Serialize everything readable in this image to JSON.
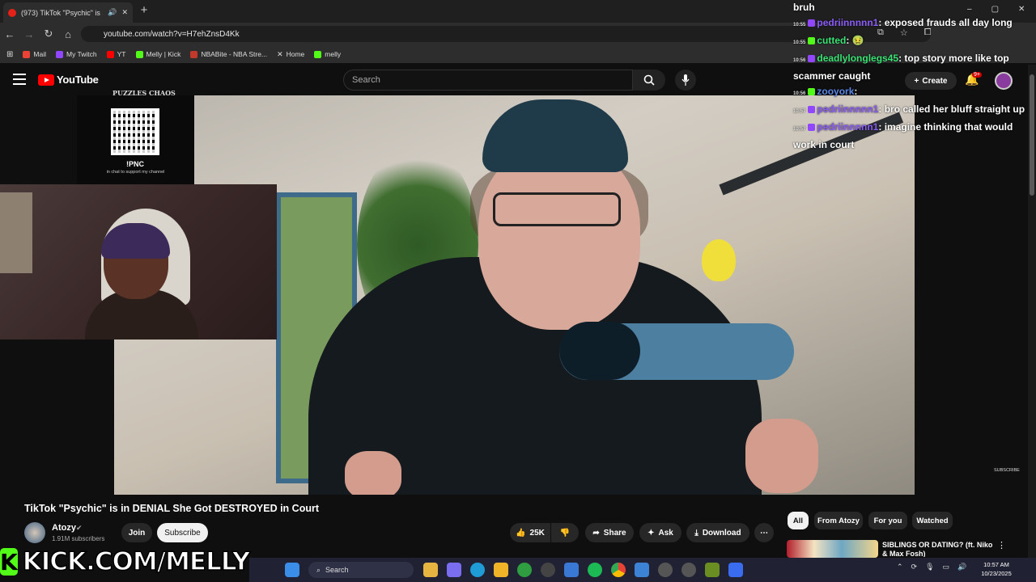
{
  "browser": {
    "tab_title": "(973) TikTok \"Psychic\" is in",
    "url": "youtube.com/watch?v=H7ehZnsD4Kk",
    "new_tab": "+",
    "bookmarks": [
      {
        "label": "Mail",
        "color": "#ea4335"
      },
      {
        "label": "My Twitch",
        "color": "#9146ff"
      },
      {
        "label": "YT",
        "color": "#ff0000"
      },
      {
        "label": "Melly | Kick",
        "color": "#53fc18"
      },
      {
        "label": "NBABite - NBA Stre...",
        "color": "#c0392b"
      },
      {
        "label": "Home",
        "color": "#ffffff"
      },
      {
        "label": "melly",
        "color": "#53fc18"
      }
    ],
    "window_controls": [
      "–",
      "▢",
      "✕"
    ]
  },
  "youtube": {
    "logo_text": "YouTube",
    "search_placeholder": "Search",
    "create_label": "Create",
    "notif_badge": "9+",
    "video": {
      "title": "TikTok \"Psychic\" is in DENIAL She Got DESTROYED in Court",
      "subscribe_watermark": "SUBSCRIBE"
    },
    "channel": {
      "name": "Atozy",
      "subscribers": "1.91M subscribers",
      "join_label": "Join",
      "subscribe_label": "Subscribe"
    },
    "actions": {
      "likes": "25K",
      "share": "Share",
      "ask": "Ask",
      "download": "Download"
    },
    "chips": [
      "All",
      "From Atozy",
      "For you",
      "Watched"
    ],
    "recommendation": {
      "title": "SIBLINGS OR DATING? (ft. Niko & Max Fosh)"
    }
  },
  "overlay": {
    "qr_label": "!PNC",
    "qr_sub": "in chat to support my channel",
    "qr_brand": "PUZZLES CHAOS",
    "kick_banner": "KICK.COM/MELLY",
    "kick_letter": "K"
  },
  "chat": {
    "lines": [
      {
        "time": "",
        "user": "",
        "msg": "bruh",
        "user_class": ""
      },
      {
        "time": "10:55",
        "user": "pedriinnnnn1",
        "msg": ": exposed frauds all day long",
        "user_class": "u-purple",
        "badge": "#9146ff"
      },
      {
        "time": "10:55",
        "user": "cutted",
        "msg": ": 🤢",
        "user_class": "u-green",
        "badge": "#53fc18"
      },
      {
        "time": "10:56",
        "user": "deadlylonglegs45",
        "msg": ": top story more like top scammer caught",
        "user_class": "u-green",
        "badge": "#9146ff"
      },
      {
        "time": "10:56",
        "user": "zooyork",
        "msg": ":",
        "user_class": "u-blue",
        "badge": "#53fc18"
      },
      {
        "time": "10:57",
        "user": "pedriinnnnn1",
        "msg": ": bro called her bluff straight up",
        "user_class": "u-purple",
        "badge": "#9146ff"
      },
      {
        "time": "10:57",
        "user": "pedriinnnnn1",
        "msg": ": imagine thinking that would work in court",
        "user_class": "u-purple",
        "badge": "#9146ff"
      }
    ]
  },
  "taskbar": {
    "search_label": "Search",
    "time": "10:57 AM",
    "date": "10/23/2025",
    "icons": [
      {
        "name": "windows-start-icon",
        "color": "#3b8ee8"
      },
      {
        "name": "file-explorer-icon",
        "color": "#e6b440"
      },
      {
        "name": "copilot-icon",
        "color": "#7a6df0"
      },
      {
        "name": "edge-icon",
        "color": "#1f9bd6"
      },
      {
        "name": "folder-icon",
        "color": "#f0b429"
      },
      {
        "name": "xbox-icon",
        "color": "#2e9e40"
      },
      {
        "name": "app-icon",
        "color": "#444"
      },
      {
        "name": "store-icon",
        "color": "#3a78d6"
      },
      {
        "name": "spotify-icon",
        "color": "#1db954"
      },
      {
        "name": "chrome-icon",
        "color": "#e8b400"
      },
      {
        "name": "photos-icon",
        "color": "#3c83d6"
      },
      {
        "name": "media-icon",
        "color": "#555"
      },
      {
        "name": "media2-icon",
        "color": "#555"
      },
      {
        "name": "minecraft-icon",
        "color": "#6b8e23"
      },
      {
        "name": "roblox-icon",
        "color": "#3a6cf0"
      }
    ]
  }
}
